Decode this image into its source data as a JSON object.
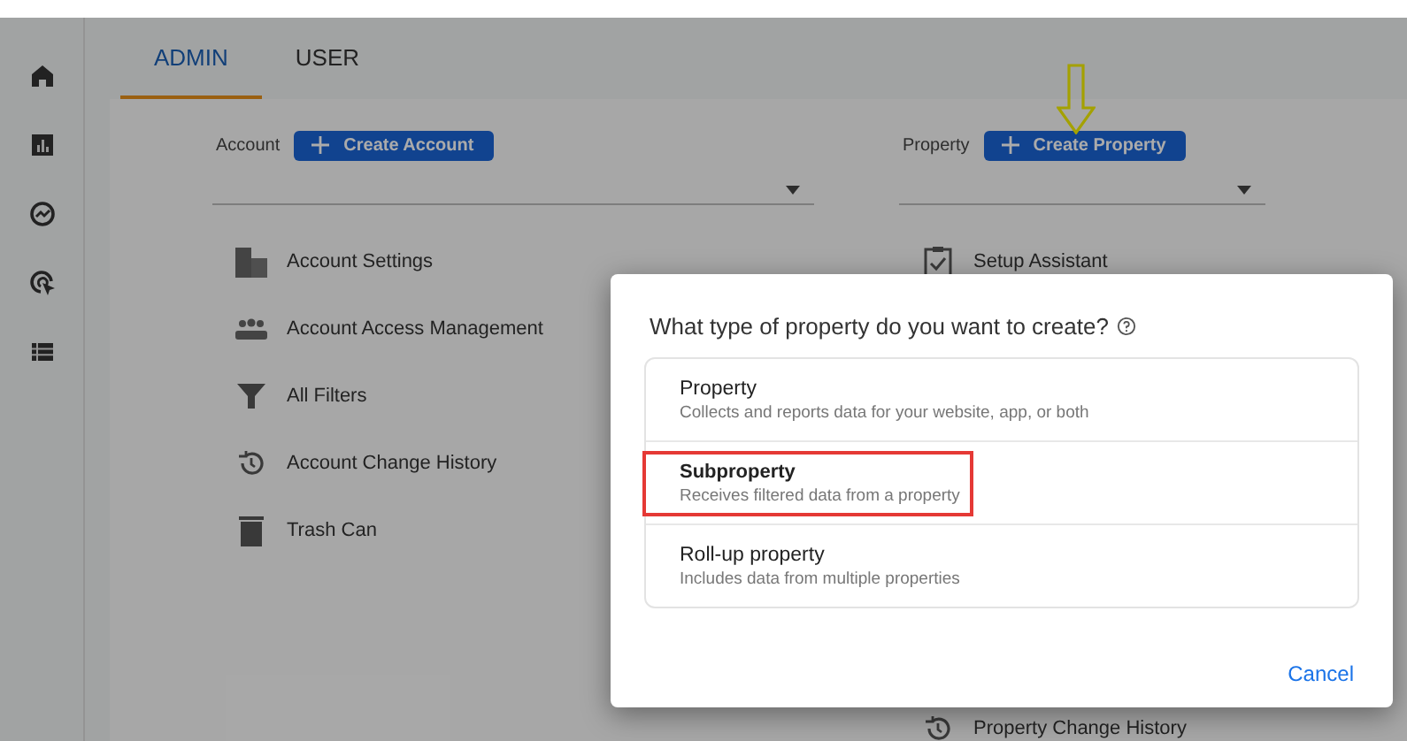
{
  "tabs": [
    {
      "label": "ADMIN",
      "selected": true
    },
    {
      "label": "USER",
      "selected": false
    }
  ],
  "account": {
    "label": "Account",
    "button": "Create Account",
    "items": [
      {
        "kind": "building",
        "label": "Account Settings"
      },
      {
        "kind": "people",
        "label": "Account Access Management"
      },
      {
        "kind": "filter",
        "label": "All Filters"
      },
      {
        "kind": "history",
        "label": "Account Change History"
      },
      {
        "kind": "trash",
        "label": "Trash Can"
      }
    ]
  },
  "property": {
    "label": "Property",
    "button": "Create Property",
    "items": [
      {
        "kind": "clipboard",
        "label": "Setup Assistant"
      },
      {
        "kind": "history",
        "label": "Property Change History"
      }
    ]
  },
  "dialog": {
    "title": "What type of property do you want to create?",
    "options": [
      {
        "title": "Property",
        "description": "Collects and reports data for your website, app, or both",
        "highlighted": false
      },
      {
        "title": "Subproperty",
        "description": "Receives filtered data from a property",
        "highlighted": true
      },
      {
        "title": "Roll-up property",
        "description": "Includes data from multiple properties",
        "highlighted": false
      }
    ],
    "cancel": "Cancel"
  }
}
